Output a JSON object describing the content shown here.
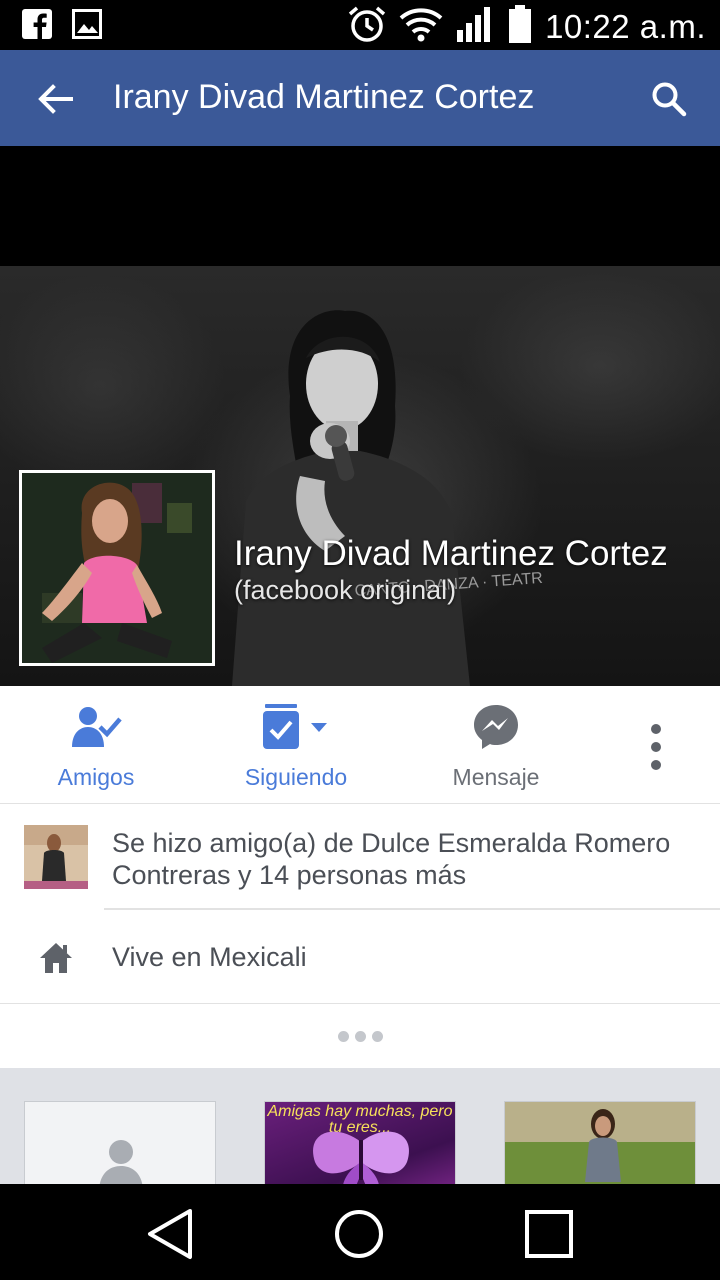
{
  "status_bar": {
    "time": "10:22 a.m.",
    "left_icons": [
      "facebook-notification-icon",
      "image-notification-icon"
    ],
    "right_icons": [
      "alarm-icon",
      "wifi-icon",
      "signal-icon",
      "battery-icon"
    ]
  },
  "app_bar": {
    "title": "Irany Divad Martinez Cortez",
    "back_icon": "arrow-back-icon",
    "search_icon": "search-icon",
    "color": "#3b5998"
  },
  "profile": {
    "name": "Irany Divad Martinez Cortez",
    "subtitle": "(facebook original)"
  },
  "actions": [
    {
      "label": "Amigos",
      "icon": "friend-check-icon",
      "color": "#4a7bd9"
    },
    {
      "label": "Siguiendo",
      "icon": "following-icon",
      "color": "#4a7bd9"
    },
    {
      "label": "Mensaje",
      "icon": "messenger-icon",
      "color": "#6b6f76"
    }
  ],
  "info": {
    "friends_text": "Se hizo amigo(a) de Dulce Esmeralda Romero Contreras y 14 personas más",
    "lives_text": "Vive en Mexicali"
  },
  "photo_strip": {
    "tile_2_text": "Amigas hay muchas, pero tu eres..."
  }
}
